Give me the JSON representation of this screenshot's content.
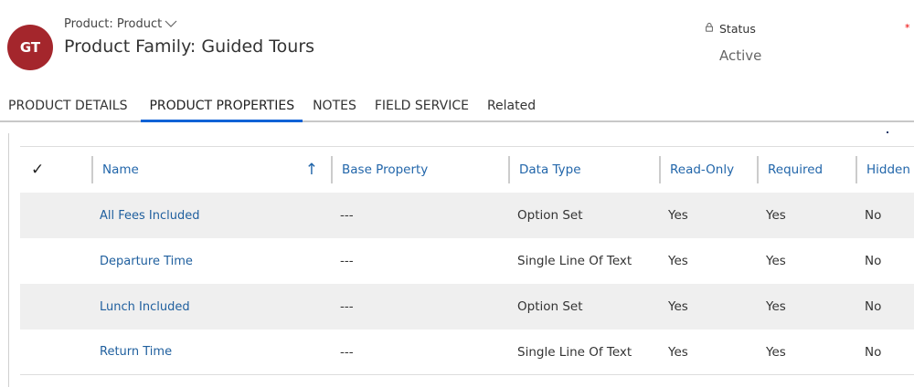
{
  "header": {
    "avatar_initials": "GT",
    "avatar_color": "#a4262c",
    "entity": "Product: Product",
    "title": "Product Family: Guided Tours",
    "status_label": "Status",
    "status_value": "Active",
    "required_mark": "*"
  },
  "tabs": [
    {
      "label": "PRODUCT DETAILS"
    },
    {
      "label": "PRODUCT PROPERTIES",
      "active": true
    },
    {
      "label": "NOTES"
    },
    {
      "label": "FIELD SERVICE"
    },
    {
      "label": "Related"
    }
  ],
  "grid": {
    "select_all": "✓",
    "columns": [
      "Name",
      "Base Property",
      "Data Type",
      "Read-Only",
      "Required",
      "Hidden"
    ],
    "sort_icon": "↑",
    "rows": [
      {
        "name": "All Fees Included",
        "base": "---",
        "type": "Option Set",
        "readonly": "Yes",
        "required": "Yes",
        "hidden": "No"
      },
      {
        "name": "Departure Time",
        "base": "---",
        "type": "Single Line Of Text",
        "readonly": "Yes",
        "required": "Yes",
        "hidden": "No"
      },
      {
        "name": "Lunch Included",
        "base": "---",
        "type": "Option Set",
        "readonly": "Yes",
        "required": "Yes",
        "hidden": "No"
      },
      {
        "name": "Return Time",
        "base": "---",
        "type": "Single Line Of Text",
        "readonly": "Yes",
        "required": "Yes",
        "hidden": "No"
      }
    ]
  }
}
